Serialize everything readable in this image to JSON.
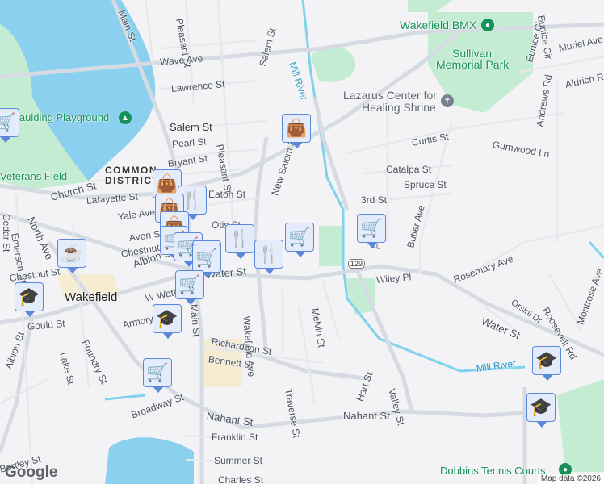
{
  "labels": {
    "main_st_n": "Main St",
    "pleasant_n": "Pleasant St",
    "salem_n": "Salem St",
    "mill_river_n": "Mill River",
    "wave": "Wave Ave",
    "lawrence": "Lawrence St",
    "spaulding": "Spaulding Playground",
    "salem": "Salem St",
    "pearl": "Pearl St",
    "bryant": "Bryant St",
    "pleasant": "Pleasant St",
    "veterans": "Veterans Field",
    "common": "COMMON",
    "district": "DISTRICT",
    "church": "Church St",
    "lafayette": "Lafayette St",
    "eaton": "Eaton St",
    "yale": "Yale Ave",
    "north": "North Ave",
    "avon": "Avon St",
    "otis": "Otis St",
    "chestnut": "Chestnut St",
    "cedar": "Cedar St",
    "emerson": "Emerson St",
    "albion": "Albion St",
    "chestnut2": "Chestnut St",
    "water": "Water St",
    "wakefield": "Wakefield",
    "w_water": "W Water St",
    "main": "Main St",
    "armory": "Armory St",
    "gould": "Gould St",
    "foundry": "Foundry St",
    "lake": "Lake St",
    "albion2": "Albion St",
    "richardson": "Richardson St",
    "bennett": "Bennett St",
    "wakefield_ave": "Wakefield Ave",
    "traverse": "Traverse St",
    "melvin": "Melvin St",
    "new_salem": "New Salem St",
    "bmx": "Wakefield BMX",
    "sullivan1": "Sullivan",
    "sullivan2": "Memorial Park",
    "lazarus1": "Lazarus Center for",
    "lazarus2": "Healing Shrine",
    "curtis": "Curtis St",
    "catalpa": "Catalpa St",
    "spruce": "Spruce St",
    "third": "3rd St",
    "gumwood": "Gumwood Ln",
    "andrews": "Andrews Rd",
    "aldrich": "Aldrich Rd",
    "muriel": "Muriel Ave",
    "eunice": "Eunice Cir",
    "eunice2": "Eunice Cir",
    "butler": "Butler Ave",
    "rosemary": "Rosemary Ave",
    "wiley": "Wiley Pl",
    "orsini": "Orsini Dr",
    "roosevelt": "Roosevelt Rd",
    "water_e": "Water St",
    "montrose": "Montrose Ave",
    "mill_river_s": "Mill River",
    "hart": "Hart St",
    "valley": "Valley St",
    "nahant": "Nahant St",
    "nahant_w": "Nahant St",
    "broadway": "Broadway St",
    "bartley": "Bartley St",
    "franklin": "Franklin St",
    "summer": "Summer St",
    "charles": "Charles St",
    "dobbins": "Dobbins Tennis Courts",
    "route": "129",
    "pr": "Pr"
  },
  "markers": [
    {
      "type": "shopping-cart",
      "glyph": "🛒"
    },
    {
      "type": "shopping-bag",
      "glyph": "👜"
    },
    {
      "type": "restaurant",
      "glyph": "🍴"
    },
    {
      "type": "coffee",
      "glyph": "☕"
    },
    {
      "type": "school",
      "glyph": "🎓"
    }
  ],
  "footer": {
    "logo": "Google",
    "attribution": "Map data ©2026"
  }
}
